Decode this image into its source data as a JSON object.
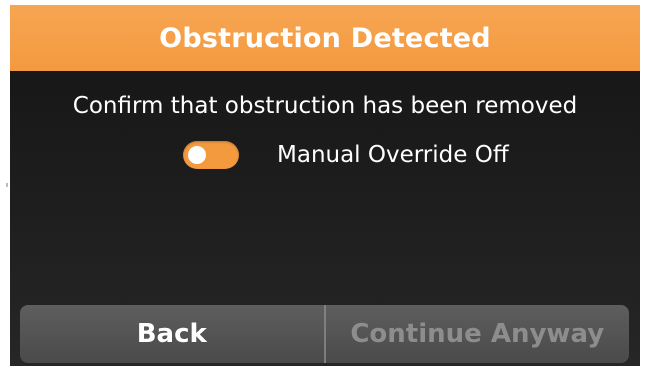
{
  "dialog": {
    "title": "Obstruction Detected",
    "message": "Confirm that obstruction has been removed"
  },
  "override": {
    "label": "Manual Override Off",
    "enabled": false,
    "toggle_color": "#f39a3f"
  },
  "buttons": {
    "back_label": "Back",
    "continue_label": "Continue Anyway"
  },
  "colors": {
    "accent": "#f39a3f",
    "background": "#1a1a1a",
    "button_bar": "#555555",
    "disabled_text": "#8d8d8d"
  }
}
